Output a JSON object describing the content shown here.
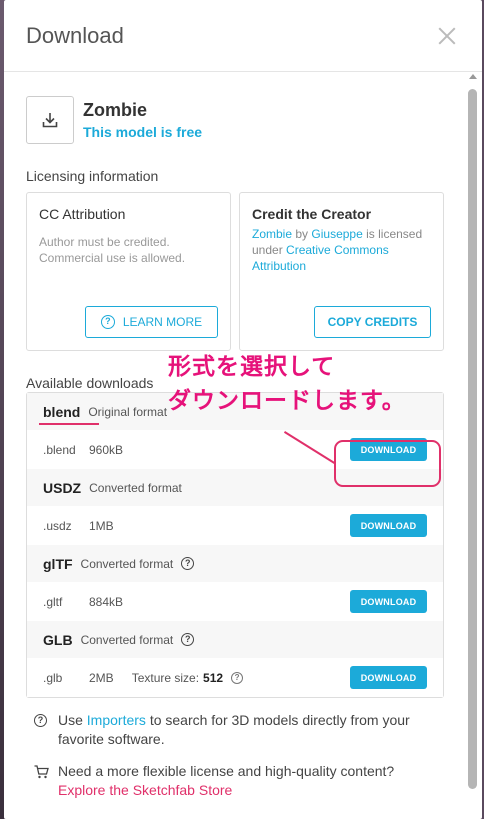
{
  "header": {
    "title": "Download"
  },
  "model": {
    "name": "Zombie",
    "status": "This model is free"
  },
  "licensing": {
    "label": "Licensing information",
    "license_card": {
      "title": "CC Attribution",
      "desc_line1": "Author must be credited.",
      "desc_line2": "Commercial use is allowed.",
      "button": "LEARN MORE"
    },
    "credit_card": {
      "title": "Credit the Creator",
      "model_link": "Zombie",
      "by": "by",
      "author_link": "Giuseppe",
      "is_licensed": "is licensed",
      "under": "under",
      "license_link_1": "Creative Commons",
      "license_link_2": "Attribution",
      "button": "COPY CREDITS"
    }
  },
  "downloads": {
    "label": "Available downloads",
    "button_label": "DOWNLOAD",
    "formats": [
      {
        "name": "blend",
        "note": "Original format",
        "ext": ".blend",
        "size": "960kB"
      },
      {
        "name": "USDZ",
        "note": "Converted format",
        "ext": ".usdz",
        "size": "1MB"
      },
      {
        "name": "glTF",
        "note": "Converted format",
        "ext": ".gltf",
        "size": "884kB"
      },
      {
        "name": "GLB",
        "note": "Converted format",
        "ext": ".glb",
        "size": "2MB",
        "texture_label": "Texture size:",
        "texture_value": "512"
      }
    ]
  },
  "footer": {
    "importers_pre": "Use",
    "importers_link": "Importers",
    "importers_post": "to search for 3D models directly from your",
    "importers_post2": "favorite software.",
    "store_text": "Need a more flexible license and high-quality content?",
    "store_link": "Explore the Sketchfab Store"
  },
  "annotation": {
    "line1": "形式を選択して",
    "line2": "ダウンロードします。"
  },
  "colors": {
    "accent": "#1caad9",
    "annotation": "#e0306a"
  }
}
